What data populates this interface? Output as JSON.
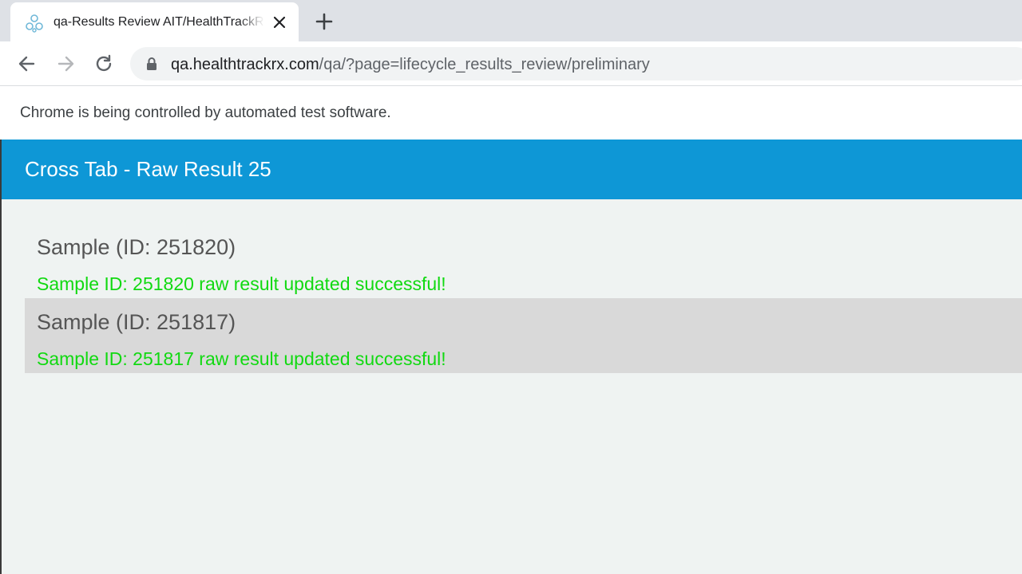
{
  "browser": {
    "tab": {
      "title": "qa-Results Review AIT/HealthTrackRx",
      "favicon": "healthtrackrx-molecule-icon"
    },
    "address": {
      "host": "qa.healthtrackrx.com",
      "path": "/qa/?page=lifecycle_results_review/preliminary"
    },
    "infobar": "Chrome is being controlled by automated test software."
  },
  "page": {
    "header_title": "Cross Tab - Raw Result 25",
    "samples": [
      {
        "title": "Sample (ID: 251820)",
        "message": "Sample ID: 251820 raw result updated successful!"
      },
      {
        "title": "Sample (ID: 251817)",
        "message": "Sample ID: 251817 raw result updated successful!"
      }
    ]
  },
  "colors": {
    "header_bg": "#0e97d6",
    "success_text": "#11d911",
    "alt_row_bg": "#d9d9d9",
    "page_bg": "#eff3f2"
  }
}
